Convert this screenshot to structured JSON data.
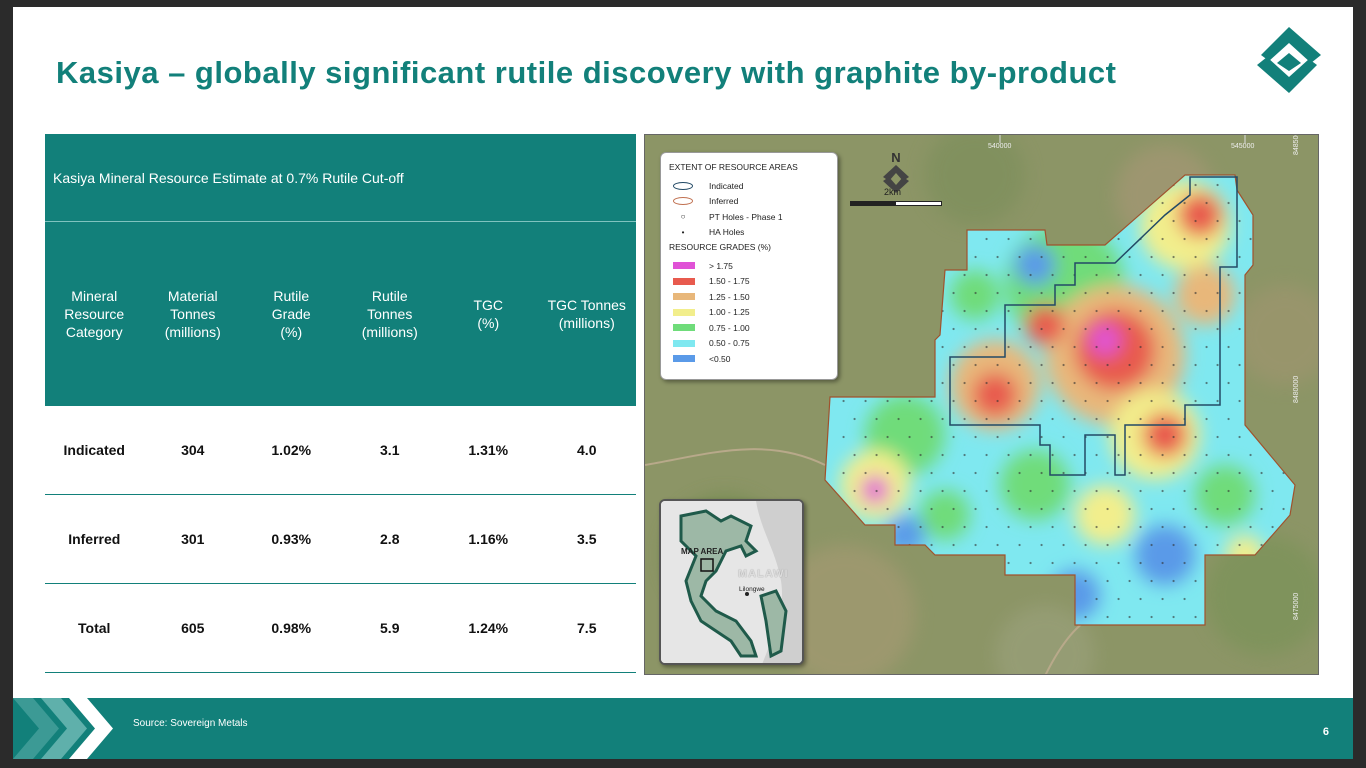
{
  "title": "Kasiya – globally significant rutile discovery with graphite by-product",
  "logo_icon": "sovereign-metals-logo",
  "table": {
    "caption": "Kasiya Mineral Resource Estimate at 0.7% Rutile Cut-off",
    "columns": [
      [
        "Mineral",
        "Resource",
        "Category"
      ],
      [
        "Material",
        "Tonnes",
        "(millions)"
      ],
      [
        "Rutile",
        "Grade",
        "(%)"
      ],
      [
        "Rutile",
        "Tonnes",
        "(millions)"
      ],
      [
        "TGC",
        "(%)"
      ],
      [
        "TGC Tonnes",
        "(millions)"
      ]
    ],
    "rows": [
      [
        "Indicated",
        "304",
        "1.02%",
        "3.1",
        "1.31%",
        "4.0"
      ],
      [
        "Inferred",
        "301",
        "0.93%",
        "2.8",
        "1.16%",
        "3.5"
      ],
      [
        "Total",
        "605",
        "0.98%",
        "5.9",
        "1.24%",
        "7.5"
      ]
    ]
  },
  "map": {
    "north": "N",
    "scale": "2km",
    "grid_labels": [
      "540000",
      "545000",
      "8485000",
      "8480000",
      "8475000"
    ],
    "legend": {
      "heading_extent": "EXTENT OF RESOURCE AREAS",
      "indicated": "Indicated",
      "inferred": "Inferred",
      "pt_holes": "PT Holes - Phase 1",
      "ha_holes": "HA Holes",
      "heading_grades": "RESOURCE GRADES (%)",
      "grades": [
        {
          "label": "> 1.75",
          "color": "#e052d6"
        },
        {
          "label": "1.50 - 1.75",
          "color": "#e85a4e"
        },
        {
          "label": "1.25 - 1.50",
          "color": "#e8b77a"
        },
        {
          "label": "1.00 - 1.25",
          "color": "#f2ee8c"
        },
        {
          "label": "0.75 - 1.00",
          "color": "#6fdc7a"
        },
        {
          "label": "0.50 - 0.75",
          "color": "#7fe8f0"
        },
        {
          "label": "<0.50",
          "color": "#5a9ae8"
        }
      ]
    },
    "inset": {
      "map_area": "MAP AREA",
      "country": "MALAWI",
      "city": "Lilongwe"
    }
  },
  "footer": {
    "source": "Source: Sovereign Metals",
    "page": "6"
  },
  "colors": {
    "brand": "#12807a"
  }
}
